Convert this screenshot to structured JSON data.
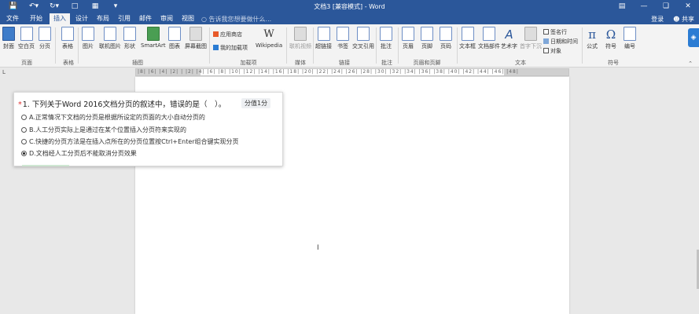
{
  "titlebar": {
    "title": "文档3 [兼容模式] - Word",
    "qat": [
      "save-icon",
      "undo-icon",
      "redo-icon",
      "new-doc-icon",
      "print-preview-icon",
      "customize-icon"
    ],
    "window_controls": [
      "ribbon-display-icon",
      "minimize-icon",
      "restore-icon",
      "close-icon"
    ]
  },
  "tabs": [
    "文件",
    "开始",
    "插入",
    "设计",
    "布局",
    "引用",
    "邮件",
    "审阅",
    "视图"
  ],
  "active_tab": "插入",
  "tellme": "告诉我您想要做什么...",
  "account": {
    "login": "登录",
    "share": "共享"
  },
  "ribbon": {
    "groups": [
      {
        "label": "页面",
        "items": [
          "封面",
          "空白页",
          "分页"
        ]
      },
      {
        "label": "表格",
        "items": [
          "表格"
        ]
      },
      {
        "label": "插图",
        "items": [
          "图片",
          "联机图片",
          "形状",
          "SmartArt",
          "图表",
          "屏幕截图"
        ]
      },
      {
        "label": "加载项",
        "items": [
          "应用商店",
          "我的加载项",
          "Wikipedia"
        ]
      },
      {
        "label": "媒体",
        "items": [
          "联机视频"
        ]
      },
      {
        "label": "链接",
        "items": [
          "超链接",
          "书签",
          "交叉引用"
        ]
      },
      {
        "label": "批注",
        "items": [
          "批注"
        ]
      },
      {
        "label": "页眉和页脚",
        "items": [
          "页眉",
          "页脚",
          "页码"
        ]
      },
      {
        "label": "文本",
        "items": [
          "文本框",
          "文档部件",
          "艺术字",
          "首字下沉",
          "签名行",
          "日期和时间",
          "对象"
        ]
      },
      {
        "label": "符号",
        "items": [
          "公式",
          "符号",
          "编号"
        ]
      }
    ]
  },
  "ruler": {
    "text": "|8| |6| |4| |2| | |2| |4| |6| |8| |10| |12| |14| |16| |18| |20| |22| |24| |26| |28| |30| |32| |34| |36| |38| |40| |42| |44| |46| |48|"
  },
  "quiz": {
    "number": "1.",
    "question": "下列关于Word 2016文档分页的叙述中，错误的是（　）。",
    "score": "分值1分",
    "options": [
      {
        "text": "A.正常情况下文档的分页是根据所设定的页面的大小自动分页的",
        "checked": false
      },
      {
        "text": "B.人工分页实际上是通过在某个位置插入分页符来实现的",
        "checked": false
      },
      {
        "text": "C.快捷的分页方法是在插入点所在的分页位置按Ctrl+Enter组合键实现分页",
        "checked": false
      },
      {
        "text": "D.文档经人工分页后不能取消分页效果",
        "checked": true
      }
    ]
  }
}
